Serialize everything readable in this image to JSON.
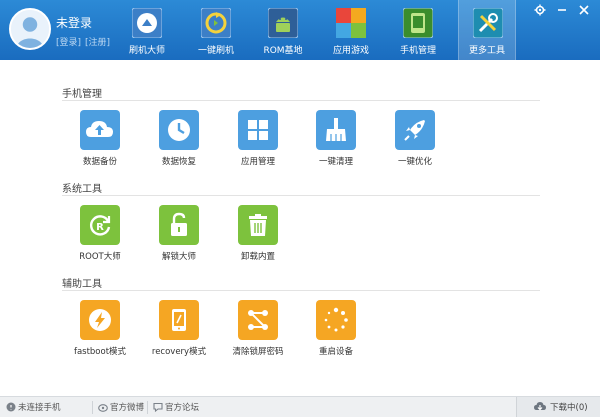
{
  "header": {
    "user_name": "未登录",
    "login_link": "[登录]",
    "register_link": "[注册]",
    "nav": [
      {
        "label": "刷机大师",
        "icon": "flash-master-icon",
        "active": false
      },
      {
        "label": "一键刷机",
        "icon": "one-click-flash-icon",
        "active": false
      },
      {
        "label": "ROM基地",
        "icon": "rom-android-icon",
        "active": false
      },
      {
        "label": "应用游戏",
        "icon": "apps-games-icon",
        "active": false
      },
      {
        "label": "手机管理",
        "icon": "phone-manage-icon",
        "active": false
      },
      {
        "label": "更多工具",
        "icon": "more-tools-icon",
        "active": true
      }
    ]
  },
  "sections": [
    {
      "title": "手机管理",
      "items": [
        {
          "label": "数据备份",
          "icon": "cloud-upload-icon",
          "color": "#4d9fe0"
        },
        {
          "label": "数据恢复",
          "icon": "clock-icon",
          "color": "#4d9fe0"
        },
        {
          "label": "应用管理",
          "icon": "app-grid-icon",
          "color": "#4d9fe0"
        },
        {
          "label": "一键清理",
          "icon": "broom-icon",
          "color": "#4d9fe0"
        },
        {
          "label": "一键优化",
          "icon": "rocket-icon",
          "color": "#4d9fe0"
        }
      ]
    },
    {
      "title": "系统工具",
      "items": [
        {
          "label": "ROOT大师",
          "icon": "root-icon",
          "color": "#7dc23d"
        },
        {
          "label": "解锁大师",
          "icon": "unlock-icon",
          "color": "#7dc23d"
        },
        {
          "label": "卸载内置",
          "icon": "trash-icon",
          "color": "#7dc23d"
        }
      ]
    },
    {
      "title": "辅助工具",
      "items": [
        {
          "label": "fastboot模式",
          "icon": "lightning-icon",
          "color": "#f5a623"
        },
        {
          "label": "recovery模式",
          "icon": "recovery-phone-icon",
          "color": "#f5a623"
        },
        {
          "label": "清除锁屏密码",
          "icon": "clear-pattern-icon",
          "color": "#f5a623"
        },
        {
          "label": "重启设备",
          "icon": "reboot-icon",
          "color": "#f5a623"
        }
      ]
    }
  ],
  "statusbar": {
    "connection": "未连接手机",
    "weibo": "官方微博",
    "forum": "官方论坛",
    "download": "下载中(0)"
  }
}
